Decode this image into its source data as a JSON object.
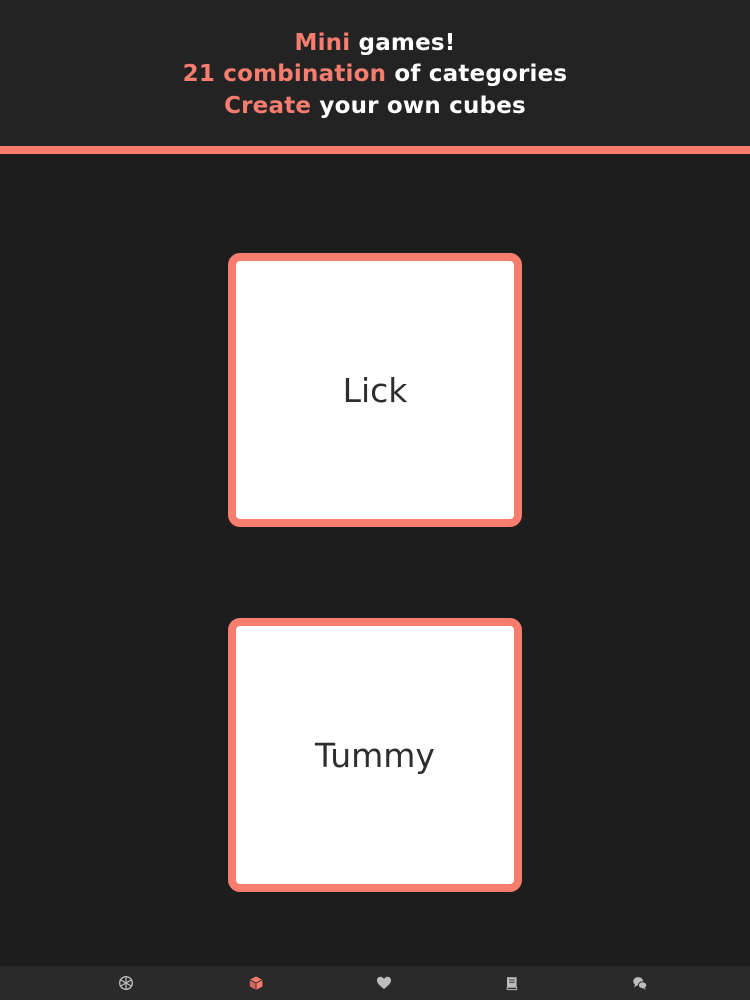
{
  "header": {
    "line1": {
      "accent": "Mini",
      "rest": " games!"
    },
    "line2": {
      "accent": "21 combination",
      "rest": " of categories"
    },
    "line3": {
      "accent": "Create",
      "rest": " your own cubes"
    }
  },
  "cubes": [
    {
      "word": "Lick"
    },
    {
      "word": "Tummy"
    }
  ],
  "tabbar": {
    "tabs": [
      {
        "icon": "dice-icon",
        "active": false
      },
      {
        "icon": "cube-icon",
        "active": true
      },
      {
        "icon": "heart-icon",
        "active": false
      },
      {
        "icon": "book-icon",
        "active": false
      },
      {
        "icon": "chat-icon",
        "active": false
      }
    ]
  },
  "colors": {
    "accent": "#f77d6f",
    "background": "#1d1d1e",
    "header_bg": "#232324",
    "tabbar_bg": "#2a2a2b",
    "icon_inactive": "#bdbdbd",
    "text_dark": "#2e2e2e"
  }
}
